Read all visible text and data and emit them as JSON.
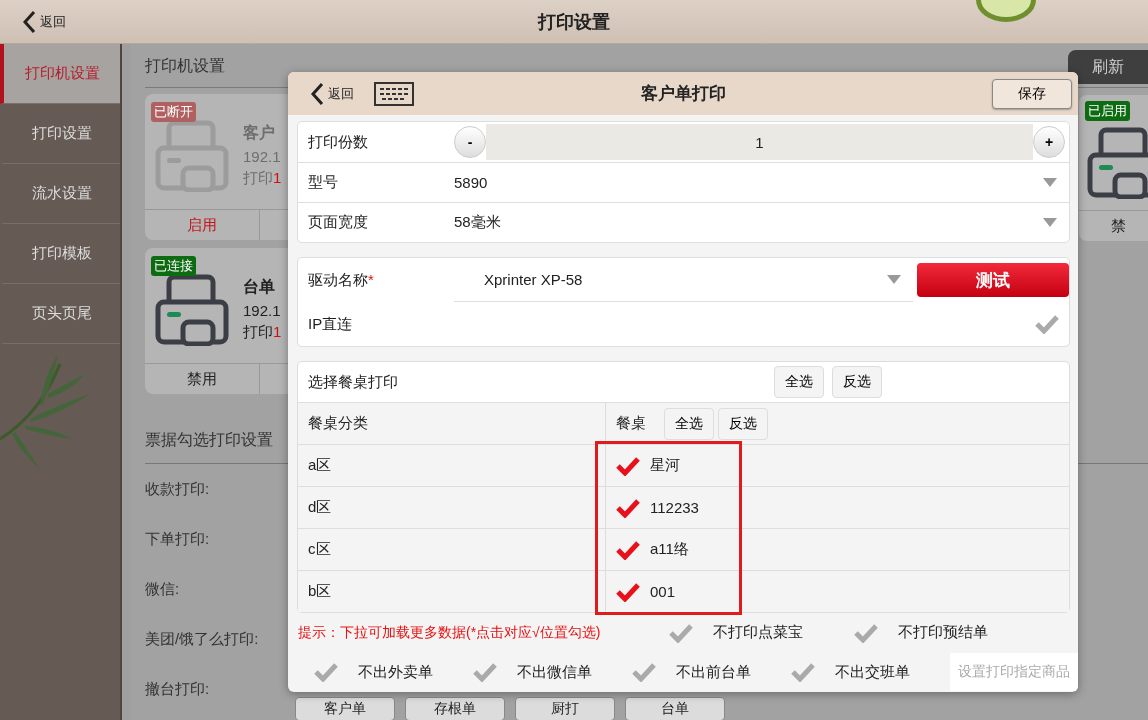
{
  "header": {
    "back": "返回",
    "title": "打印设置"
  },
  "sidebar": {
    "items": [
      {
        "label": "打印机设置",
        "selected": true
      },
      {
        "label": "打印设置",
        "selected": false
      },
      {
        "label": "流水设置",
        "selected": false
      },
      {
        "label": "打印模板",
        "selected": false
      },
      {
        "label": "页头页尾",
        "selected": false
      }
    ]
  },
  "printers": {
    "title": "打印机设置",
    "refresh": "刷新",
    "cards": [
      {
        "kind": "disconnected",
        "status": "已断开",
        "name": "客户",
        "address": "192.1",
        "print_label": "打印",
        "copies": "1",
        "action": "启用"
      },
      {
        "kind": "connected",
        "status": "已连接",
        "name": "台单",
        "address": "192.1",
        "print_label": "打印",
        "copies": "1",
        "action": "禁用"
      }
    ],
    "side_card": {
      "kind": "connected",
      "status": "已启用",
      "action": "禁"
    }
  },
  "receipt_settings": {
    "title": "票据勾选打印设置",
    "rows": [
      "收款打印:",
      "下单打印:",
      "微信:",
      "美团/饿了么打印:",
      "撤台打印:"
    ],
    "tags": [
      "客户单",
      "存根单",
      "厨打",
      "台单"
    ]
  },
  "modal": {
    "back": "返回",
    "title": "客户单打印",
    "save": "保存",
    "copies": {
      "label": "打印份数",
      "minus": "-",
      "value": "1",
      "plus": "+"
    },
    "selects": [
      {
        "label": "型号",
        "value": "5890"
      },
      {
        "label": "页面宽度",
        "value": "58毫米"
      }
    ],
    "driver": {
      "label": "驱动名称",
      "required_mark": "*",
      "value": "Xprinter XP-58",
      "test": "测试"
    },
    "ip_direct": {
      "label": "IP直连",
      "checked": false
    },
    "tables": {
      "title": "选择餐桌打印",
      "select_all": "全选",
      "invert": "反选",
      "columns": [
        "餐桌分类",
        "餐桌"
      ],
      "column_select_all": "全选",
      "column_invert": "反选",
      "rows": [
        {
          "category": "a区",
          "table": "星河",
          "checked": true
        },
        {
          "category": "d区",
          "table": "112233",
          "checked": true
        },
        {
          "category": "c区",
          "table": "a11络",
          "checked": true
        },
        {
          "category": "b区",
          "table": "001",
          "checked": true
        }
      ]
    },
    "hint": "提示：下拉可加载更多数据(*点击对应√位置勾选)",
    "options": [
      {
        "label": "不打印点菜宝",
        "checked": false
      },
      {
        "label": "不打印预结单",
        "checked": false
      },
      {
        "label": "不出外卖单",
        "checked": false
      },
      {
        "label": "不出微信单",
        "checked": false
      },
      {
        "label": "不出前台单",
        "checked": false
      },
      {
        "label": "不出交班单",
        "checked": false
      }
    ],
    "specify_button": "设置打印指定商品"
  }
}
